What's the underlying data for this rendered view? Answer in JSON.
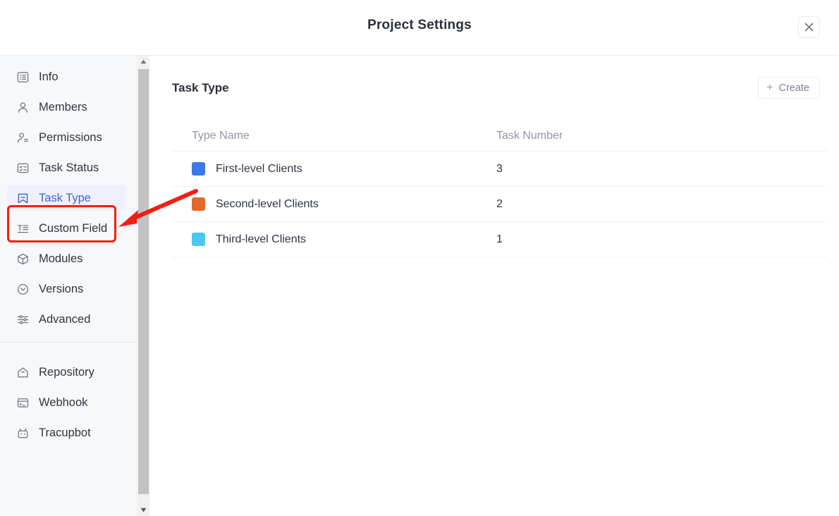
{
  "header": {
    "title": "Project Settings",
    "close_icon": "close-icon"
  },
  "sidebar": {
    "groups": [
      {
        "items": [
          {
            "label": "Info",
            "icon": "list-box-icon",
            "active": false
          },
          {
            "label": "Members",
            "icon": "person-icon",
            "active": false
          },
          {
            "label": "Permissions",
            "icon": "person-lines-icon",
            "active": false
          },
          {
            "label": "Task Status",
            "icon": "checklist-box-icon",
            "active": false
          },
          {
            "label": "Task Type",
            "icon": "bookmark-icon",
            "active": true
          },
          {
            "label": "Custom Field",
            "icon": "text-field-icon",
            "active": false
          },
          {
            "label": "Modules",
            "icon": "cube-icon",
            "active": false
          },
          {
            "label": "Versions",
            "icon": "clock-chevron-icon",
            "active": false
          },
          {
            "label": "Advanced",
            "icon": "sliders-icon",
            "active": false
          }
        ]
      },
      {
        "items": [
          {
            "label": "Repository",
            "icon": "repository-icon",
            "active": false
          },
          {
            "label": "Webhook",
            "icon": "terminal-icon",
            "active": false
          },
          {
            "label": "Tracupbot",
            "icon": "robot-icon",
            "active": false
          }
        ]
      }
    ],
    "scrollbar": {
      "up_icon": "scroll-up-arrow-icon",
      "down_icon": "scroll-down-arrow-icon"
    }
  },
  "main": {
    "panel_title": "Task Type",
    "create_button": {
      "label": "Create",
      "icon": "plus-icon"
    },
    "table": {
      "columns": [
        "Type Name",
        "Task Number"
      ],
      "rows": [
        {
          "color": "#3d78e8",
          "name": "First-level Clients",
          "count": "3"
        },
        {
          "color": "#e2682b",
          "name": "Second-level Clients",
          "count": "2"
        },
        {
          "color": "#4bc6f0",
          "name": "Third-level Clients",
          "count": "1"
        }
      ]
    }
  },
  "annotations": {
    "highlight_color": "#f41e10",
    "arrow_color": "#f41e10"
  }
}
